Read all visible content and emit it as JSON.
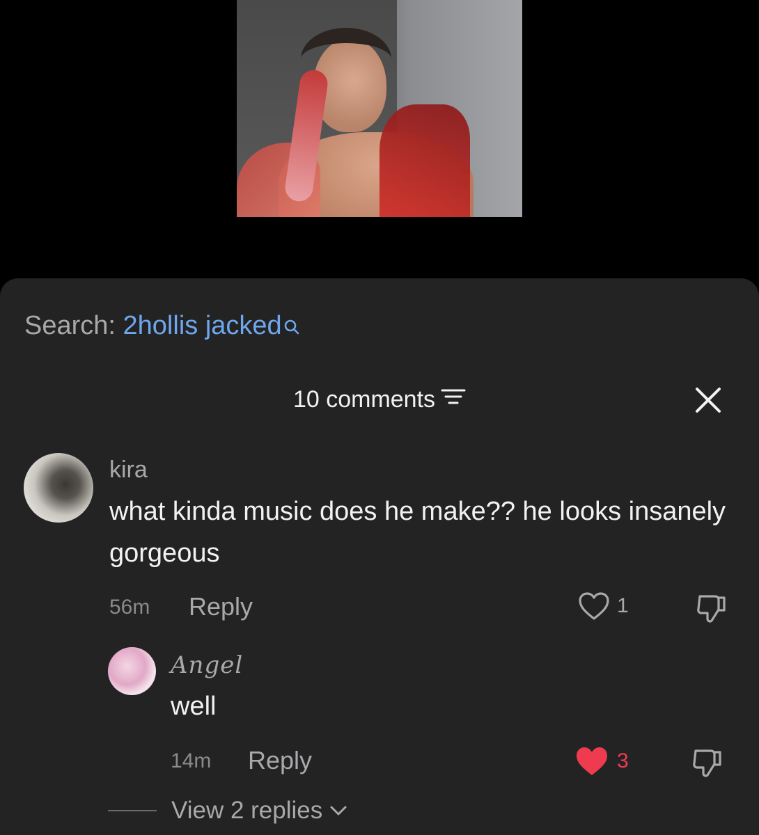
{
  "search": {
    "prefix": "Search:",
    "query": "2hollis jacked"
  },
  "comments_header": {
    "count_label": "10 comments"
  },
  "comments": [
    {
      "username": "kira",
      "text": "what kinda music does he make?? he looks insanely gorgeous",
      "time": "56m",
      "reply_label": "Reply",
      "likes": "1",
      "liked": false
    },
    {
      "username": "Angel",
      "text": "well",
      "time": "14m",
      "reply_label": "Reply",
      "likes": "3",
      "liked": true
    }
  ],
  "view_replies_label": "View 2 replies",
  "colors": {
    "sheet_background": "#232324",
    "search_query": "#6fa7ee",
    "liked_heart": "#ee3b4f",
    "primary_text": "#f2f2f2",
    "secondary_text": "#a9a9ab"
  },
  "icons": [
    "search-icon",
    "filter-icon",
    "close-icon",
    "heart-icon",
    "heart-filled-icon",
    "dislike-icon",
    "chevron-down-icon"
  ]
}
